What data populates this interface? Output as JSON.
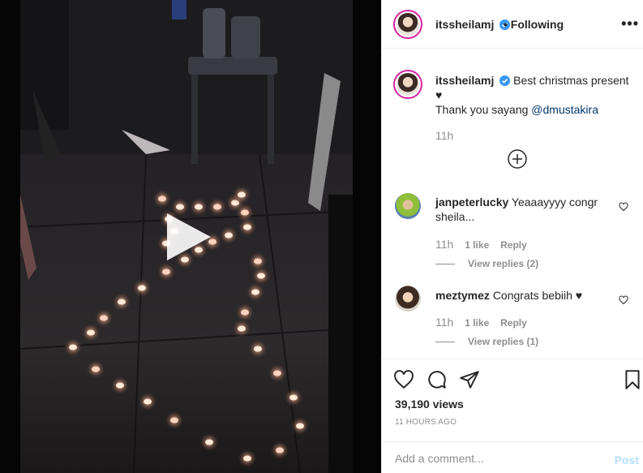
{
  "post": {
    "username": "itssheilamj",
    "follow_status": "Following",
    "more": "•••",
    "caption_line1": "Best christmas present",
    "caption_heart": "♥",
    "caption_line2_prefix": "Thank you sayang ",
    "caption_mention": "@dmustakira",
    "caption_time": "11h",
    "accent_ring": "#d6249f",
    "verified_color": "#3897f0"
  },
  "comments": [
    {
      "username": "janpeterlucky",
      "text_line1": "Yeaaayyyy congr",
      "text_line2": "sheila...",
      "time": "11h",
      "likes": "1 like",
      "reply": "Reply",
      "view_replies": "View replies (2)"
    },
    {
      "username": "meztymez",
      "text_line1": "Congrats bebiih",
      "heart": "♥",
      "time": "11h",
      "likes": "1 like",
      "reply": "Reply",
      "view_replies": "View replies (1)"
    }
  ],
  "stats": {
    "views": "39,190 views",
    "posted": "11 HOURS AGO"
  },
  "comment_box": {
    "placeholder": "Add a comment...",
    "post_label": "Post"
  },
  "icons": {
    "play": "play-icon",
    "add": "plus-circle-icon",
    "like": "heart-icon",
    "comment": "comment-icon",
    "share": "send-icon",
    "save": "bookmark-icon"
  }
}
